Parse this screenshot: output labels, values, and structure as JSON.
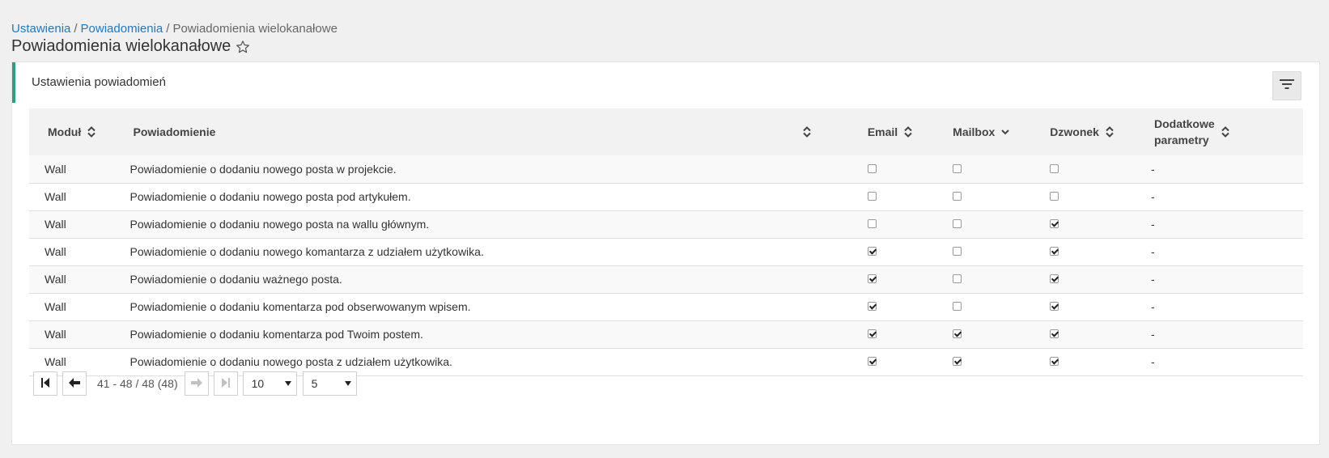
{
  "breadcrumb": {
    "items": [
      "Ustawienia",
      "Powiadomienia",
      "Powiadomienia wielokanałowe"
    ],
    "separator": "/"
  },
  "page": {
    "title": "Powiadomienia wielokanałowe",
    "title_icon": "star-icon"
  },
  "panel": {
    "title": "Ustawienia powiadomień",
    "filter_icon": "filter-icon",
    "accent_color": "#2e9e7e"
  },
  "table": {
    "headers": {
      "module": "Moduł",
      "notification": "Powiadomienie",
      "email": "Email",
      "mailbox": "Mailbox",
      "bell": "Dzwonek",
      "extra_line1": "Dodatkowe",
      "extra_line2": "parametry"
    },
    "rows": [
      {
        "module": "Wall",
        "notification": "Powiadomienie o dodaniu nowego posta w projekcie.",
        "email": false,
        "mailbox": false,
        "bell": false,
        "extra": "-"
      },
      {
        "module": "Wall",
        "notification": "Powiadomienie o dodaniu nowego posta pod artykułem.",
        "email": false,
        "mailbox": false,
        "bell": false,
        "extra": "-"
      },
      {
        "module": "Wall",
        "notification": "Powiadomienie o dodaniu nowego posta na wallu głównym.",
        "email": false,
        "mailbox": false,
        "bell": true,
        "extra": "-"
      },
      {
        "module": "Wall",
        "notification": "Powiadomienie o dodaniu nowego komantarza z udziałem użytkowika.",
        "email": true,
        "mailbox": false,
        "bell": true,
        "extra": "-"
      },
      {
        "module": "Wall",
        "notification": "Powiadomienie o dodaniu ważnego posta.",
        "email": true,
        "mailbox": false,
        "bell": true,
        "extra": "-"
      },
      {
        "module": "Wall",
        "notification": "Powiadomienie o dodaniu komentarza pod obserwowanym wpisem.",
        "email": true,
        "mailbox": false,
        "bell": true,
        "extra": "-"
      },
      {
        "module": "Wall",
        "notification": "Powiadomienie o dodaniu komentarza pod Twoim postem.",
        "email": true,
        "mailbox": true,
        "bell": true,
        "extra": "-"
      },
      {
        "module": "Wall",
        "notification": "Powiadomienie o dodaniu nowego posta z udziałem użytkowika.",
        "email": true,
        "mailbox": true,
        "bell": true,
        "extra": "-"
      }
    ]
  },
  "pager": {
    "info": "41 - 48 / 48 (48)",
    "page_size_value": "10",
    "page_number_value": "5"
  }
}
